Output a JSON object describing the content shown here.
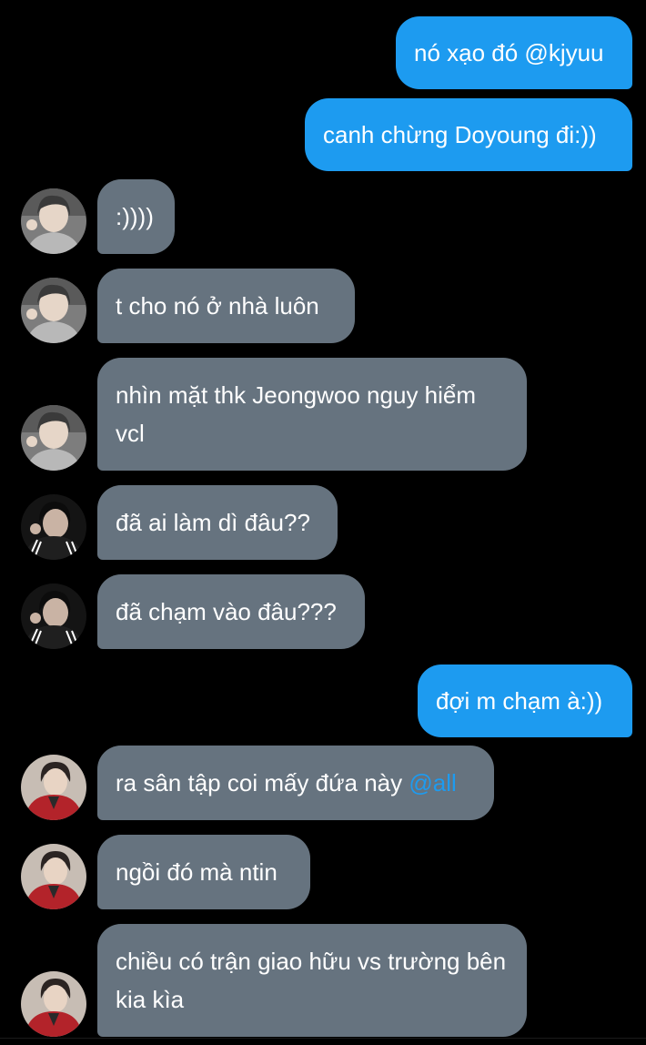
{
  "conversation": {
    "messages": [
      {
        "direction": "outgoing",
        "text": "nó xạo đó @kjyuu"
      },
      {
        "direction": "outgoing",
        "text": "canh chừng Doyoung đi:))"
      },
      {
        "direction": "incoming",
        "sender_avatar": "user-a-avatar",
        "text": ":))))"
      },
      {
        "direction": "incoming",
        "sender_avatar": "user-a-avatar",
        "text": "t cho nó ở nhà luôn"
      },
      {
        "direction": "incoming",
        "sender_avatar": "user-a-avatar",
        "text": "nhìn mặt thk Jeongwoo nguy hiểm vcl"
      },
      {
        "direction": "incoming",
        "sender_avatar": "user-b-avatar",
        "text": "đã ai làm dì đâu??"
      },
      {
        "direction": "incoming",
        "sender_avatar": "user-b-avatar",
        "text": "đã chạm vào đâu???"
      },
      {
        "direction": "outgoing",
        "text": "đợi m chạm à:))"
      },
      {
        "direction": "incoming",
        "sender_avatar": "user-c-avatar",
        "text_before_mention": "ra sân tập coi mấy đứa này ",
        "mention": "@all"
      },
      {
        "direction": "incoming",
        "sender_avatar": "user-c-avatar",
        "text": "ngồi đó mà ntin"
      },
      {
        "direction": "incoming",
        "sender_avatar": "user-c-avatar",
        "text": "chiều có trận giao hữu vs trường bên kia kìa"
      }
    ]
  },
  "colors": {
    "background": "#000000",
    "outgoing_bubble": "#1d9bf0",
    "incoming_bubble": "#66737f",
    "mention": "#1d9bf0",
    "text": "#ffffff"
  }
}
